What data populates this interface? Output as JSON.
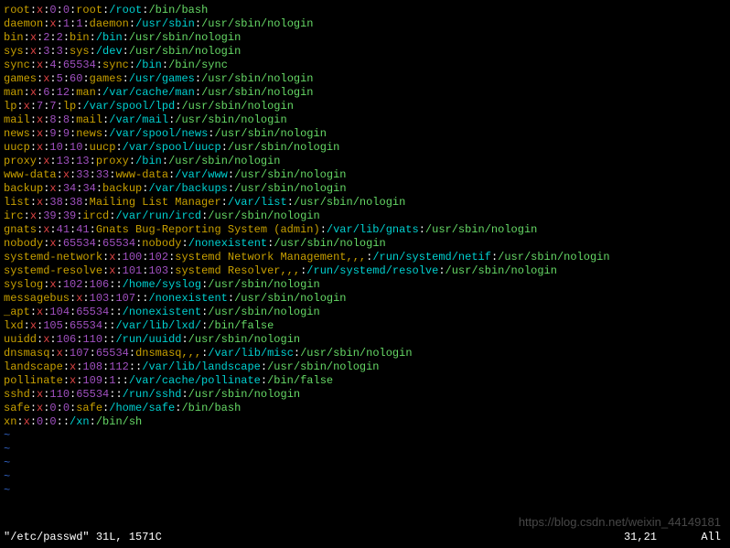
{
  "lines": [
    {
      "user": "root",
      "x": "x",
      "uid": "0",
      "gid": "0",
      "name": "root",
      "home": "/root",
      "shell": "/bin/bash"
    },
    {
      "user": "daemon",
      "x": "x",
      "uid": "1",
      "gid": "1",
      "name": "daemon",
      "home": "/usr/sbin",
      "shell": "/usr/sbin/nologin"
    },
    {
      "user": "bin",
      "x": "x",
      "uid": "2",
      "gid": "2",
      "name": "bin",
      "home": "/bin",
      "shell": "/usr/sbin/nologin"
    },
    {
      "user": "sys",
      "x": "x",
      "uid": "3",
      "gid": "3",
      "name": "sys",
      "home": "/dev",
      "shell": "/usr/sbin/nologin"
    },
    {
      "user": "sync",
      "x": "x",
      "uid": "4",
      "gid": "65534",
      "name": "sync",
      "home": "/bin",
      "shell": "/bin/sync"
    },
    {
      "user": "games",
      "x": "x",
      "uid": "5",
      "gid": "60",
      "name": "games",
      "home": "/usr/games",
      "shell": "/usr/sbin/nologin"
    },
    {
      "user": "man",
      "x": "x",
      "uid": "6",
      "gid": "12",
      "name": "man",
      "home": "/var/cache/man",
      "shell": "/usr/sbin/nologin"
    },
    {
      "user": "lp",
      "x": "x",
      "uid": "7",
      "gid": "7",
      "name": "lp",
      "home": "/var/spool/lpd",
      "shell": "/usr/sbin/nologin"
    },
    {
      "user": "mail",
      "x": "x",
      "uid": "8",
      "gid": "8",
      "name": "mail",
      "home": "/var/mail",
      "shell": "/usr/sbin/nologin"
    },
    {
      "user": "news",
      "x": "x",
      "uid": "9",
      "gid": "9",
      "name": "news",
      "home": "/var/spool/news",
      "shell": "/usr/sbin/nologin"
    },
    {
      "user": "uucp",
      "x": "x",
      "uid": "10",
      "gid": "10",
      "name": "uucp",
      "home": "/var/spool/uucp",
      "shell": "/usr/sbin/nologin"
    },
    {
      "user": "proxy",
      "x": "x",
      "uid": "13",
      "gid": "13",
      "name": "proxy",
      "home": "/bin",
      "shell": "/usr/sbin/nologin"
    },
    {
      "user": "www-data",
      "x": "x",
      "uid": "33",
      "gid": "33",
      "name": "www-data",
      "home": "/var/www",
      "shell": "/usr/sbin/nologin"
    },
    {
      "user": "backup",
      "x": "x",
      "uid": "34",
      "gid": "34",
      "name": "backup",
      "home": "/var/backups",
      "shell": "/usr/sbin/nologin"
    },
    {
      "user": "list",
      "x": "x",
      "uid": "38",
      "gid": "38",
      "name": "Mailing List Manager",
      "home": "/var/list",
      "shell": "/usr/sbin/nologin"
    },
    {
      "user": "irc",
      "x": "x",
      "uid": "39",
      "gid": "39",
      "name": "ircd",
      "home": "/var/run/ircd",
      "shell": "/usr/sbin/nologin"
    },
    {
      "user": "gnats",
      "x": "x",
      "uid": "41",
      "gid": "41",
      "name": "Gnats Bug-Reporting System (admin)",
      "home": "/var/lib/gnats",
      "shell": "/usr/sbin/nologin"
    },
    {
      "user": "nobody",
      "x": "x",
      "uid": "65534",
      "gid": "65534",
      "name": "nobody",
      "home": "/nonexistent",
      "shell": "/usr/sbin/nologin"
    },
    {
      "user": "systemd-network",
      "x": "x",
      "uid": "100",
      "gid": "102",
      "name": "systemd Network Management,,,",
      "home": "/run/systemd/netif",
      "shell": "/usr/sbin/nologin"
    },
    {
      "user": "systemd-resolve",
      "x": "x",
      "uid": "101",
      "gid": "103",
      "name": "systemd Resolver,,,",
      "home": "/run/systemd/resolve",
      "shell": "/usr/sbin/nologin"
    },
    {
      "user": "syslog",
      "x": "x",
      "uid": "102",
      "gid": "106",
      "name": "",
      "home": "/home/syslog",
      "shell": "/usr/sbin/nologin"
    },
    {
      "user": "messagebus",
      "x": "x",
      "uid": "103",
      "gid": "107",
      "name": "",
      "home": "/nonexistent",
      "shell": "/usr/sbin/nologin"
    },
    {
      "user": "_apt",
      "x": "x",
      "uid": "104",
      "gid": "65534",
      "name": "",
      "home": "/nonexistent",
      "shell": "/usr/sbin/nologin"
    },
    {
      "user": "lxd",
      "x": "x",
      "uid": "105",
      "gid": "65534",
      "name": "",
      "home": "/var/lib/lxd/",
      "shell": "/bin/false"
    },
    {
      "user": "uuidd",
      "x": "x",
      "uid": "106",
      "gid": "110",
      "name": "",
      "home": "/run/uuidd",
      "shell": "/usr/sbin/nologin"
    },
    {
      "user": "dnsmasq",
      "x": "x",
      "uid": "107",
      "gid": "65534",
      "name": "dnsmasq,,,",
      "home": "/var/lib/misc",
      "shell": "/usr/sbin/nologin"
    },
    {
      "user": "landscape",
      "x": "x",
      "uid": "108",
      "gid": "112",
      "name": "",
      "home": "/var/lib/landscape",
      "shell": "/usr/sbin/nologin"
    },
    {
      "user": "pollinate",
      "x": "x",
      "uid": "109",
      "gid": "1",
      "name": "",
      "home": "/var/cache/pollinate",
      "shell": "/bin/false"
    },
    {
      "user": "sshd",
      "x": "x",
      "uid": "110",
      "gid": "65534",
      "name": "",
      "home": "/run/sshd",
      "shell": "/usr/sbin/nologin"
    },
    {
      "user": "safe",
      "x": "x",
      "uid": "0",
      "gid": "0",
      "name": "safe",
      "home": "/home/safe",
      "shell": "/bin/bash"
    },
    {
      "user": "xn",
      "x": "x",
      "uid": "0",
      "gid": "0",
      "name": "",
      "home": "/xn",
      "shell": "/bin/sh"
    }
  ],
  "tilde": "~",
  "status_text": "\"/etc/passwd\" 31L, 1571C",
  "cursor_pos": "31,21",
  "mode_text": "All",
  "watermark": "https://blog.csdn.net/weixin_44149181"
}
